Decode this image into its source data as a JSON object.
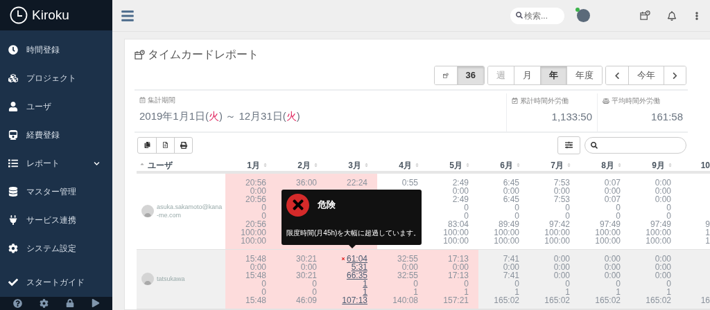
{
  "app": {
    "name": "Kiroku"
  },
  "sidebar": {
    "items": [
      {
        "label": "時間登録",
        "has_submenu": false
      },
      {
        "label": "プロジェクト",
        "has_submenu": false
      },
      {
        "label": "ユーザ",
        "has_submenu": false
      },
      {
        "label": "経費登録",
        "has_submenu": false
      },
      {
        "label": "レポート",
        "has_submenu": true
      },
      {
        "label": "マスター管理",
        "has_submenu": false
      },
      {
        "label": "サービス連携",
        "has_submenu": false
      },
      {
        "label": "システム設定",
        "has_submenu": false
      },
      {
        "label": "スタートガイド",
        "has_submenu": false
      }
    ]
  },
  "topbar": {
    "search": {
      "placeholder": "検索..."
    },
    "user": {
      "online": true
    }
  },
  "page": {
    "title": "タイムカードレポート"
  },
  "toolbar": {
    "groups": [
      {
        "buttons": [
          {
            "kind": "icon",
            "selected": false,
            "disabled": false
          },
          {
            "kind": "text",
            "label": "36",
            "selected": true,
            "disabled": false
          }
        ]
      },
      {
        "buttons": [
          {
            "kind": "text",
            "label": "週",
            "selected": false,
            "disabled": true
          },
          {
            "kind": "text",
            "label": "月",
            "selected": false,
            "disabled": false
          },
          {
            "kind": "text",
            "label": "年",
            "selected": true,
            "disabled": false
          },
          {
            "kind": "text",
            "label": "年度",
            "selected": false,
            "disabled": false
          }
        ]
      },
      {
        "buttons": [
          {
            "kind": "prev",
            "selected": false,
            "disabled": false
          },
          {
            "kind": "text",
            "label": "今年",
            "selected": false,
            "disabled": false
          },
          {
            "kind": "next",
            "selected": false,
            "disabled": false
          }
        ]
      }
    ]
  },
  "period": {
    "label": "集計期間",
    "parts": [
      {
        "text": "2019年1月1日(",
        "holiday": false
      },
      {
        "text": "火",
        "holiday": true
      },
      {
        "text": ") ～ 12月31日(",
        "holiday": false
      },
      {
        "text": "火",
        "holiday": true
      },
      {
        "text": ")",
        "holiday": false
      }
    ]
  },
  "stats": [
    {
      "label": "累計時間外労働",
      "value": "1,133:50"
    },
    {
      "label": "平均時間外労働",
      "value": "161:58"
    }
  ],
  "table": {
    "user_header": "ユーザ",
    "columns": [
      "1月",
      "2月",
      "3月",
      "4月",
      "5月",
      "6月",
      "7月",
      "8月",
      "9月",
      "10"
    ],
    "rows": [
      {
        "user": "asuka.sakamoto@kana-me.com",
        "shaded": false,
        "cells": [
          {
            "warn": true,
            "link": false,
            "alert": false,
            "clipped": false,
            "values": [
              "20:56",
              "0:00",
              "20:56",
              "0",
              "0",
              "20:56",
              "100:00",
              "100:00"
            ]
          },
          {
            "warn": true,
            "link": false,
            "alert": false,
            "clipped": false,
            "values": [
              "36:00"
            ]
          },
          {
            "warn": true,
            "link": false,
            "alert": false,
            "clipped": false,
            "values": [
              "22:24"
            ]
          },
          {
            "warn": false,
            "link": false,
            "alert": false,
            "clipped": false,
            "values": [
              "0:55"
            ]
          },
          {
            "warn": false,
            "link": false,
            "alert": false,
            "clipped": false,
            "values": [
              "2:49",
              "0:00",
              "2:49",
              "0",
              "0",
              "83:04",
              "100:00",
              "100:00"
            ]
          },
          {
            "warn": false,
            "link": false,
            "alert": false,
            "clipped": false,
            "values": [
              "6:45",
              "0:00",
              "6:45",
              "0",
              "0",
              "89:49",
              "100:00",
              "100:00"
            ]
          },
          {
            "warn": false,
            "link": false,
            "alert": false,
            "clipped": false,
            "values": [
              "7:53",
              "0:00",
              "7:53",
              "0",
              "0",
              "97:42",
              "100:00",
              "100:00"
            ]
          },
          {
            "warn": false,
            "link": false,
            "alert": false,
            "clipped": false,
            "values": [
              "0:07",
              "0:00",
              "0:07",
              "0",
              "0",
              "97:49",
              "100:00",
              "100:00"
            ]
          },
          {
            "warn": false,
            "link": false,
            "alert": false,
            "clipped": false,
            "values": [
              "0:00",
              "0:00",
              "0:00",
              "0",
              "0",
              "97:49",
              "100:00",
              "100:00"
            ]
          },
          {
            "warn": false,
            "link": false,
            "alert": false,
            "clipped": true,
            "values": [
              "9",
              "1",
              "1"
            ]
          }
        ]
      },
      {
        "user": "tatsukawa",
        "shaded": true,
        "cells": [
          {
            "warn": true,
            "link": false,
            "alert": false,
            "clipped": false,
            "values": [
              "15:48",
              "0:00",
              "15:48",
              "0",
              "0",
              "15:48"
            ]
          },
          {
            "warn": true,
            "link": false,
            "alert": false,
            "clipped": false,
            "values": [
              "30:21",
              "0:00",
              "30:21",
              "0",
              "0",
              "46:09"
            ]
          },
          {
            "warn": true,
            "link": true,
            "alert": true,
            "clipped": false,
            "values": [
              "61:04",
              "5:31",
              "66:35",
              "1",
              "1",
              "107:13"
            ]
          },
          {
            "warn": true,
            "link": false,
            "alert": false,
            "clipped": false,
            "values": [
              "32:55",
              "0:00",
              "32:55",
              "0",
              "1",
              "140:08"
            ]
          },
          {
            "warn": true,
            "link": false,
            "alert": false,
            "clipped": false,
            "values": [
              "17:13",
              "0:00",
              "17:13",
              "0",
              "1",
              "157:21"
            ]
          },
          {
            "warn": false,
            "link": false,
            "alert": false,
            "clipped": false,
            "values": [
              "7:41",
              "0:00",
              "7:41",
              "0",
              "1",
              "165:02"
            ]
          },
          {
            "warn": false,
            "link": false,
            "alert": false,
            "clipped": false,
            "values": [
              "0:00",
              "0:00",
              "0:00",
              "0",
              "1",
              "165:02"
            ]
          },
          {
            "warn": false,
            "link": false,
            "alert": false,
            "clipped": false,
            "values": [
              "0:00",
              "0:00",
              "0:00",
              "0",
              "1",
              "165:02"
            ]
          },
          {
            "warn": false,
            "link": false,
            "alert": false,
            "clipped": false,
            "values": [
              "0:00",
              "0:00",
              "0:00",
              "0",
              "1",
              "165:02"
            ]
          },
          {
            "warn": false,
            "link": false,
            "alert": false,
            "clipped": true,
            "values": [
              "16"
            ]
          }
        ]
      }
    ]
  },
  "tooltip": {
    "title": "危険",
    "message": "限度時間(月45h)を大幅に超過しています。"
  }
}
